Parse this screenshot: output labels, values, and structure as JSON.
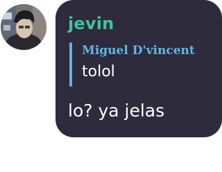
{
  "message": {
    "avatar_icon": "user-avatar-photo",
    "username": "jevin",
    "username_color": "#3ec4a0",
    "bubble_color": "#2d2b3c",
    "reply": {
      "author": "Miguel D'vincent",
      "author_color": "#63b6e6",
      "bar_color": "#5fb4e6",
      "text": "tolol"
    },
    "text": "lo? ya jelas"
  }
}
